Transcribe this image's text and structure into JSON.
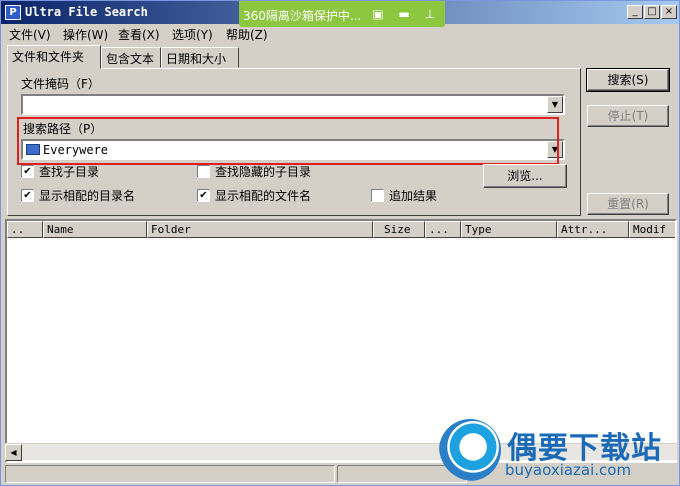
{
  "window": {
    "title": "Ultra File Search",
    "app_icon": "P",
    "buttons": {
      "minimize": "_",
      "maximize": "□",
      "close": "×"
    }
  },
  "overlay": {
    "text": "360隔离沙箱保护中...",
    "icons": [
      "shield-icon",
      "folder-icon",
      "pin-icon"
    ]
  },
  "menu": [
    "文件(V)",
    "操作(W)",
    "查看(X)",
    "选项(Y)",
    "帮助(Z)"
  ],
  "tabs": [
    "文件和文件夹",
    "包含文本",
    "日期和大小"
  ],
  "form": {
    "mask_label": "文件掩码（F）",
    "mask_value": "",
    "path_label": "搜索路径（P）",
    "path_value": "Everywere",
    "options": [
      {
        "label": "查找子目录",
        "checked": true
      },
      {
        "label": "查找隐藏的子目录",
        "checked": false
      },
      {
        "label": "显示相配的目录名",
        "checked": true
      },
      {
        "label": "显示相配的文件名",
        "checked": true
      },
      {
        "label": "追加结果",
        "checked": false
      }
    ],
    "browse": "浏览..."
  },
  "actions": {
    "search": "搜索(S)",
    "stop": "停止(T)",
    "reset": "重置(R)"
  },
  "columns": [
    "..",
    "Name",
    "Folder",
    "Size",
    "...",
    "Type",
    "Attr...",
    "Modif"
  ],
  "watermark": {
    "title": "偶要下载站",
    "url": "buyaoxiazai.com"
  },
  "colors": {
    "highlight_box": "#e02020",
    "overlay_bg": "#8dc63f",
    "title_bar": "#0a246a"
  }
}
